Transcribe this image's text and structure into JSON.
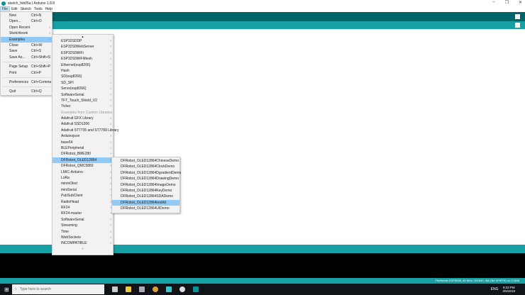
{
  "window": {
    "title": "sketch_feb05a | Arduino 1.8.8",
    "controls": [
      "–",
      "❐",
      "✕"
    ]
  },
  "menubar": [
    "File",
    "Edit",
    "Sketch",
    "Tools",
    "Help"
  ],
  "file_menu": [
    {
      "label": "New",
      "shortcut": "Ctrl+N"
    },
    {
      "label": "Open...",
      "shortcut": "Ctrl+O"
    },
    {
      "label": "Open Recent",
      "submenu": true
    },
    {
      "label": "Sketchbook",
      "submenu": true
    },
    {
      "label": "Examples",
      "submenu": true,
      "highlighted": true
    },
    {
      "label": "Close",
      "shortcut": "Ctrl+W"
    },
    {
      "label": "Save",
      "shortcut": "Ctrl+S"
    },
    {
      "label": "Save As...",
      "shortcut": "Ctrl+Shift+S"
    },
    {
      "sep": true
    },
    {
      "label": "Page Setup",
      "shortcut": "Ctrl+Shift+P"
    },
    {
      "label": "Print",
      "shortcut": "Ctrl+P"
    },
    {
      "sep": true
    },
    {
      "label": "Preferences",
      "shortcut": "Ctrl+Comma"
    },
    {
      "sep": true
    },
    {
      "label": "Quit",
      "shortcut": "Ctrl+Q"
    }
  ],
  "examples_menu": {
    "scroll_up": "▲",
    "scroll_down": "▼",
    "items": [
      {
        "label": "ESP32SDDP"
      },
      {
        "label": "ESP32S0WebServer"
      },
      {
        "label": "ESP32S0WiFi"
      },
      {
        "label": "ESP32S0WiFiMesh"
      },
      {
        "label": "Ethernet(esp8266)"
      },
      {
        "label": "Hash"
      },
      {
        "label": "SD(esp8266)"
      },
      {
        "label": "SD_SPI"
      },
      {
        "label": "Servo(esp8266)"
      },
      {
        "label": "SoftwareSerial"
      },
      {
        "label": "TFT_Touch_Shield_V2"
      },
      {
        "label": "Ticker"
      },
      {
        "header": "Examples from Custom Libraries"
      },
      {
        "label": "Adafruit GFX Library"
      },
      {
        "label": "Adafruit SSD1306"
      },
      {
        "label": "Adafruit ST7735 and ST7789 Library"
      },
      {
        "label": "Arduinojson"
      },
      {
        "label": "base64"
      },
      {
        "label": "BLEPeripheral"
      },
      {
        "label": "DFRobot_BME280"
      },
      {
        "label": "DFRobot_OLED12864",
        "highlighted": true
      },
      {
        "label": "DFRobot_QMC5883"
      },
      {
        "label": "LMIC-Arduino"
      },
      {
        "label": "LoRa"
      },
      {
        "label": "minmOled"
      },
      {
        "label": "miniSerial"
      },
      {
        "label": "PubSubClient"
      },
      {
        "label": "RadioHead"
      },
      {
        "label": "RF24"
      },
      {
        "label": "RF24-master"
      },
      {
        "label": "SoftwareSerial"
      },
      {
        "label": "Streaming"
      },
      {
        "label": "Time"
      },
      {
        "label": "WebSockets"
      },
      {
        "label": "INCOMPATIBLE"
      }
    ]
  },
  "oled_menu": [
    {
      "label": "DFRobot_OLED12864ChineseDemo"
    },
    {
      "label": "DFRobot_OLED12864ClockDemo"
    },
    {
      "label": "DFRobot_OLED12864DgradientDemo"
    },
    {
      "label": "DFRobot_OLED12864DrawingDemo"
    },
    {
      "label": "DFRobot_OLED12864ImageDemo"
    },
    {
      "label": "DFRobot_OLED12864KeyDemo"
    },
    {
      "label": "DFRobot_OLED12864SDADemo"
    },
    {
      "label": "DFRobot_OLED12864textAll",
      "highlighted": true
    },
    {
      "label": "DFRobot_OLED12864UIDemo"
    }
  ],
  "status_bar": "FireBeetle-ESP8266, 80 MHz, 921600, 4M (3M SPIFFS) on COM8",
  "taskbar": {
    "search_placeholder": "Type here to search",
    "time": "9:23 PM",
    "date": "2/5/2019",
    "lang": "ENG",
    "apps": [
      "task-view",
      "file-explorer",
      "mail",
      "chrome",
      "app-green",
      "obs",
      "arduino"
    ]
  },
  "colors": {
    "toolbar": "#006468",
    "tabs": "#17a1a5",
    "highlight": "#91c9f7"
  }
}
